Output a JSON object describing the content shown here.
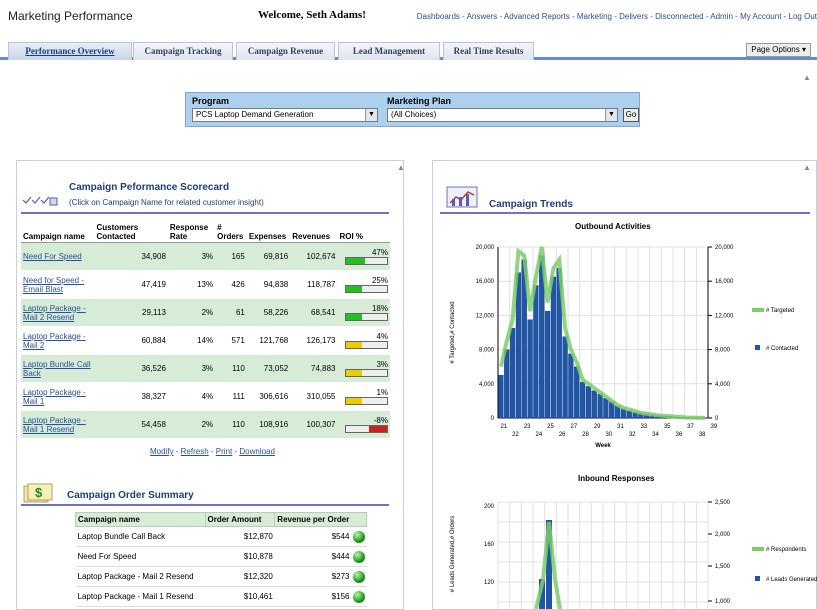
{
  "header": {
    "app_title": "Marketing Performance",
    "welcome": "Welcome, Seth Adams!",
    "links": [
      "Dashboards",
      "Answers",
      "Advanced Reports",
      "Marketing",
      "Delivers",
      "Disconnected",
      "Admin",
      "My Account",
      "Log Out"
    ]
  },
  "tabs": [
    "Performance Overview",
    "Campaign Tracking",
    "Campaign Revenue",
    "Lead Management",
    "Real Time Results"
  ],
  "page_options": "Page Options",
  "prompts": {
    "program_label": "Program",
    "program_value": "PCS Laptop Demand Generation",
    "plan_label": "Marketing Plan",
    "plan_value": "(All Choices)",
    "go": "Go"
  },
  "scorecard": {
    "title": "Campaign Peformance Scorecard",
    "subtitle": "(Click on Campaign Name for related customer insight)",
    "headers": [
      "Campaign name",
      "Customers Contacted",
      "Response Rate",
      "# Orders",
      "Expenses",
      "Revenues",
      "ROI %"
    ],
    "rows": [
      {
        "name": "Need For Speed",
        "contacted": "34,908",
        "rate": "3%",
        "orders": "165",
        "expenses": "69,816",
        "revenues": "102,674",
        "roi": "47%",
        "roi_value": 0.47,
        "roi_color": "#22c022"
      },
      {
        "name": "Need for Speed - Email Blast",
        "contacted": "47,419",
        "rate": "13%",
        "orders": "426",
        "expenses": "94,838",
        "revenues": "118,787",
        "roi": "25%",
        "roi_value": 0.25,
        "roi_color": "#22c022"
      },
      {
        "name": "Laptop Package - Mail 2 Resend",
        "contacted": "29,113",
        "rate": "2%",
        "orders": "61",
        "expenses": "58,226",
        "revenues": "68,541",
        "roi": "18%",
        "roi_value": 0.18,
        "roi_color": "#22c022"
      },
      {
        "name": "Laptop Package - Mail 2",
        "contacted": "60,884",
        "rate": "14%",
        "orders": "571",
        "expenses": "121,768",
        "revenues": "126,173",
        "roi": "4%",
        "roi_value": 0.04,
        "roi_color": "#e8d000"
      },
      {
        "name": "Laptop Bundle Call Back",
        "contacted": "36,526",
        "rate": "3%",
        "orders": "110",
        "expenses": "73,052",
        "revenues": "74,883",
        "roi": "3%",
        "roi_value": 0.03,
        "roi_color": "#e8d000"
      },
      {
        "name": "Laptop Package - Mail 1",
        "contacted": "38,327",
        "rate": "4%",
        "orders": "111",
        "expenses": "306,616",
        "revenues": "310,055",
        "roi": "1%",
        "roi_value": 0.01,
        "roi_color": "#e8d000"
      },
      {
        "name": "Laptop Package - Mail 1 Resend",
        "contacted": "54,458",
        "rate": "2%",
        "orders": "110",
        "expenses": "108,916",
        "revenues": "100,307",
        "roi": "-8%",
        "roi_value": -0.08,
        "roi_color": "#cc2020"
      }
    ],
    "actions": [
      "Modify",
      "Refresh",
      "Print",
      "Download"
    ]
  },
  "order_summary": {
    "title": "Campaign Order Summary",
    "headers": [
      "Campaign name",
      "Order Amount",
      "Revenue per Order"
    ],
    "rows": [
      {
        "name": "Laptop Bundle Call Back",
        "amount": "$12,870",
        "rpo": "$544"
      },
      {
        "name": "Need For Speed",
        "amount": "$10,878",
        "rpo": "$444"
      },
      {
        "name": "Laptop Package - Mail 2 Resend",
        "amount": "$12,320",
        "rpo": "$273"
      },
      {
        "name": "Laptop Package - Mail 1 Resend",
        "amount": "$10,461",
        "rpo": "$156"
      }
    ]
  },
  "trends": {
    "title": "Campaign Trends",
    "chart_data": [
      {
        "type": "bar",
        "title": "Outbound Activities",
        "xlabel": "Week",
        "ylabel": "# Targeted,# Contacted",
        "ylim": [
          0,
          20000
        ],
        "y_ticks": [
          "0",
          "4,000",
          "8,000",
          "12,000",
          "16,000",
          "20,000"
        ],
        "y2_ticks": [
          "0",
          "4,000",
          "8,000",
          "12,000",
          "16,000",
          "20,000"
        ],
        "x_labels_top": [
          "21",
          "23",
          "25",
          "27",
          "29",
          "31",
          "33",
          "35",
          "37",
          "39"
        ],
        "x_labels_bottom": [
          "22",
          "24",
          "26",
          "28",
          "30",
          "32",
          "34",
          "36",
          "38"
        ],
        "legend_position": "right",
        "series": [
          {
            "name": "# Targeted",
            "type": "line",
            "color": "#7ccc6a",
            "values": [
              6000,
              9000,
              11500,
              19500,
              19000,
              12500,
              16500,
              20000,
              13500,
              17500,
              18500,
              10500,
              8000,
              6500,
              4500,
              4000,
              3500,
              3000,
              2500,
              2000,
              1500,
              1200,
              1000,
              800,
              600,
              500,
              400,
              300,
              250,
              200,
              150,
              100,
              50,
              40,
              30,
              20
            ]
          },
          {
            "name": "# Contacted",
            "type": "bar",
            "color": "#1f56a8",
            "values": [
              5000,
              8000,
              10500,
              17000,
              18500,
              11500,
              15500,
              19000,
              12500,
              16500,
              17500,
              9500,
              7500,
              6000,
              4200,
              3700,
              3200,
              2800,
              2300,
              1900,
              1400,
              1100,
              900,
              700,
              550,
              450,
              350,
              280,
              220,
              180,
              130,
              90,
              45,
              35,
              25,
              15
            ]
          }
        ]
      },
      {
        "type": "bar",
        "title": "Inbound Responses",
        "ylabel": "# Leads Generated,# Orders",
        "y_ticks": [
          "120",
          "160",
          "200"
        ],
        "y2_ticks": [
          "1,000",
          "1,500",
          "2,000",
          "2,500"
        ],
        "legend_position": "right",
        "series": [
          {
            "name": "# Respondents",
            "type": "line",
            "color": "#7ccc6a"
          },
          {
            "name": "# Leads Generated",
            "type": "bar",
            "color": "#1f56a8"
          }
        ]
      }
    ]
  }
}
